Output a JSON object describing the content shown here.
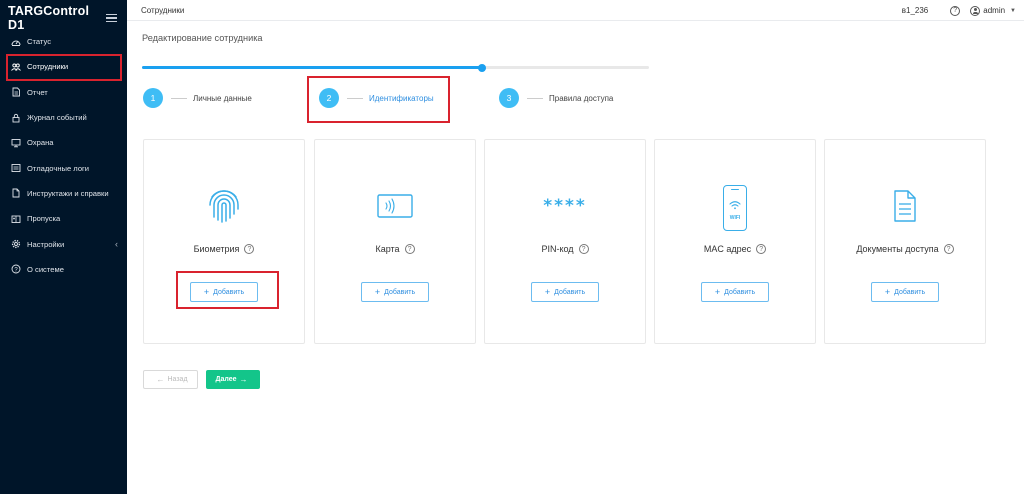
{
  "app": {
    "brand": "TARGControl D1"
  },
  "sidebar": {
    "items": [
      {
        "label": "Статус",
        "icon": "dashboard-icon"
      },
      {
        "label": "Сотрудники",
        "icon": "users-icon"
      },
      {
        "label": "Отчет",
        "icon": "report-icon"
      },
      {
        "label": "Журнал событий",
        "icon": "lock-icon"
      },
      {
        "label": "Охрана",
        "icon": "monitor-icon"
      },
      {
        "label": "Отладочные логи",
        "icon": "list-icon"
      },
      {
        "label": "Инструктажи и справки",
        "icon": "document-icon"
      },
      {
        "label": "Пропуска",
        "icon": "pass-icon"
      },
      {
        "label": "Настройки",
        "icon": "gear-icon"
      },
      {
        "label": "О системе",
        "icon": "question-icon"
      }
    ],
    "active_index": 1,
    "settings_chevron": "‹"
  },
  "topbar": {
    "title": "Сотрудники",
    "code": "в1_236",
    "help": "?",
    "user": "admin",
    "caret": "▼"
  },
  "main": {
    "page_title": "Редактирование сотрудника",
    "progress": 0.67,
    "steps": [
      {
        "number": "1",
        "label": "Личные данные"
      },
      {
        "number": "2",
        "label": "Идентификаторы"
      },
      {
        "number": "3",
        "label": "Правила доступа"
      }
    ],
    "current_step": 2,
    "cards": [
      {
        "title": "Биометрия",
        "icon": "fingerprint-icon",
        "add_label": "Добавить"
      },
      {
        "title": "Карта",
        "icon": "card-icon",
        "add_label": "Добавить"
      },
      {
        "title": "PIN-код",
        "icon": "pin-icon",
        "add_label": "Добавить",
        "icon_text": "****"
      },
      {
        "title": "MAC адрес",
        "icon": "phone-wifi-icon",
        "add_label": "Добавить",
        "icon_text": "WIFI"
      },
      {
        "title": "Документы доступа",
        "icon": "document-icon",
        "add_label": "Добавить"
      }
    ],
    "help_mark": "?",
    "plus": "+",
    "back_label": "Назад",
    "back_arrow": "←",
    "next_label": "Далее",
    "next_arrow": "→"
  },
  "colors": {
    "sidebar_bg": "#001529",
    "accent": "#1aa0f0",
    "step_circle": "#3fbdf5",
    "next_button": "#13c58a",
    "highlight": "#d9232e"
  }
}
